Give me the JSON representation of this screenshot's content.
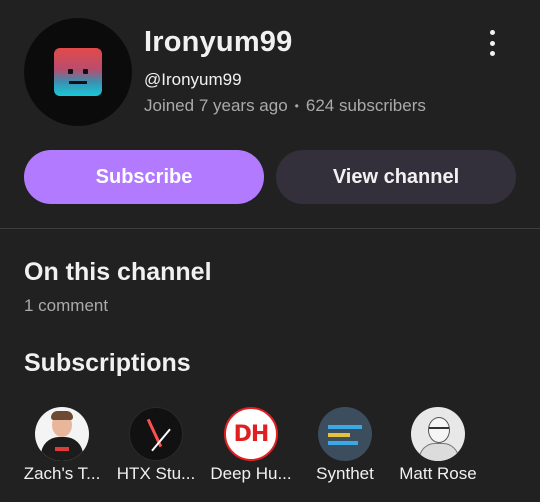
{
  "channel": {
    "name": "Ironyum99",
    "handle": "@Ironyum99",
    "joined": "Joined 7 years ago",
    "separator": "•",
    "subscribers": "624 subscribers"
  },
  "buttons": {
    "subscribe": "Subscribe",
    "view_channel": "View channel"
  },
  "sections": {
    "on_this_channel": "On this channel",
    "comment_count": "1 comment",
    "subscriptions": "Subscriptions"
  },
  "subscriptions": [
    {
      "label": "Zach's T...",
      "avatar_text": ""
    },
    {
      "label": "HTX Stu...",
      "avatar_text": ""
    },
    {
      "label": "Deep Hu...",
      "avatar_text": "DH"
    },
    {
      "label": "Synthet",
      "avatar_text": ""
    },
    {
      "label": "Matt Rose",
      "avatar_text": ""
    }
  ],
  "colors": {
    "background": "#212121",
    "subscribe_button": "#b27bff",
    "view_channel_button": "#33303b",
    "secondary_text": "#aaaaaa"
  },
  "icons": {
    "more": "more-vertical-icon"
  }
}
